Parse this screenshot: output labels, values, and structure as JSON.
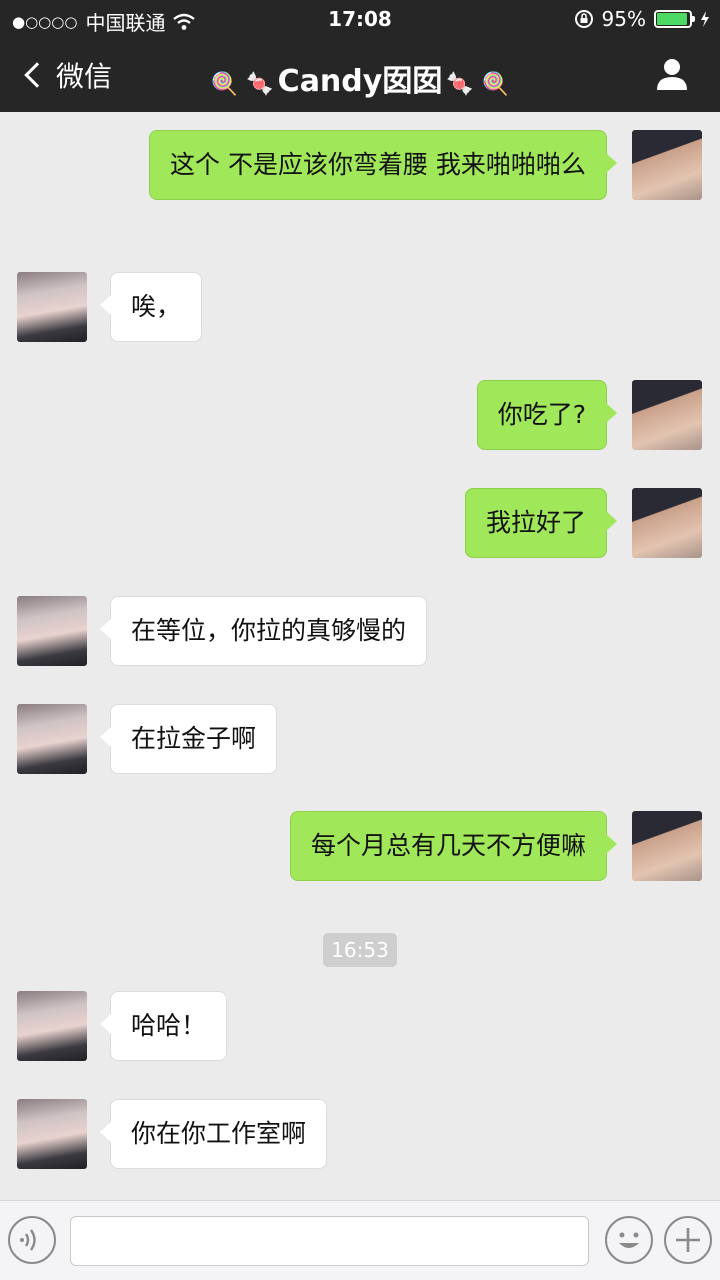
{
  "status_bar": {
    "signal": "●○○○○",
    "carrier": "中国联通",
    "time": "17:08",
    "battery_percent": "95%",
    "battery_level": 0.95
  },
  "nav": {
    "back_label": "微信",
    "title": "Candy囡囡"
  },
  "messages": [
    {
      "from": "me",
      "text": "这个 不是应该你弯着腰 我来啪啪啪么"
    },
    {
      "from": "her",
      "text": "唉，"
    },
    {
      "from": "me",
      "text": "你吃了?"
    },
    {
      "from": "me",
      "text": "我拉好了"
    },
    {
      "from": "her",
      "text": "在等位，你拉的真够慢的"
    },
    {
      "from": "her",
      "text": "在拉金子啊"
    },
    {
      "from": "me",
      "text": "每个月总有几天不方便嘛"
    },
    {
      "from": "her",
      "text": "哈哈！"
    },
    {
      "from": "her",
      "text": "你在你工作室啊"
    }
  ],
  "timestamp": "16:53",
  "input": {
    "value": "",
    "placeholder": ""
  },
  "icons": {
    "voice": "voice-icon",
    "emoji": "emoji-icon",
    "plus": "plus-icon",
    "profile": "profile-icon",
    "wifi": "wifi-icon",
    "lock": "rotation-lock-icon",
    "charging": "charging-icon"
  },
  "colors": {
    "bar_bg": "#262626",
    "chat_bg": "#ebebeb",
    "my_bubble": "#a0e75a",
    "her_bubble": "#ffffff",
    "battery_fill": "#4cd964"
  }
}
